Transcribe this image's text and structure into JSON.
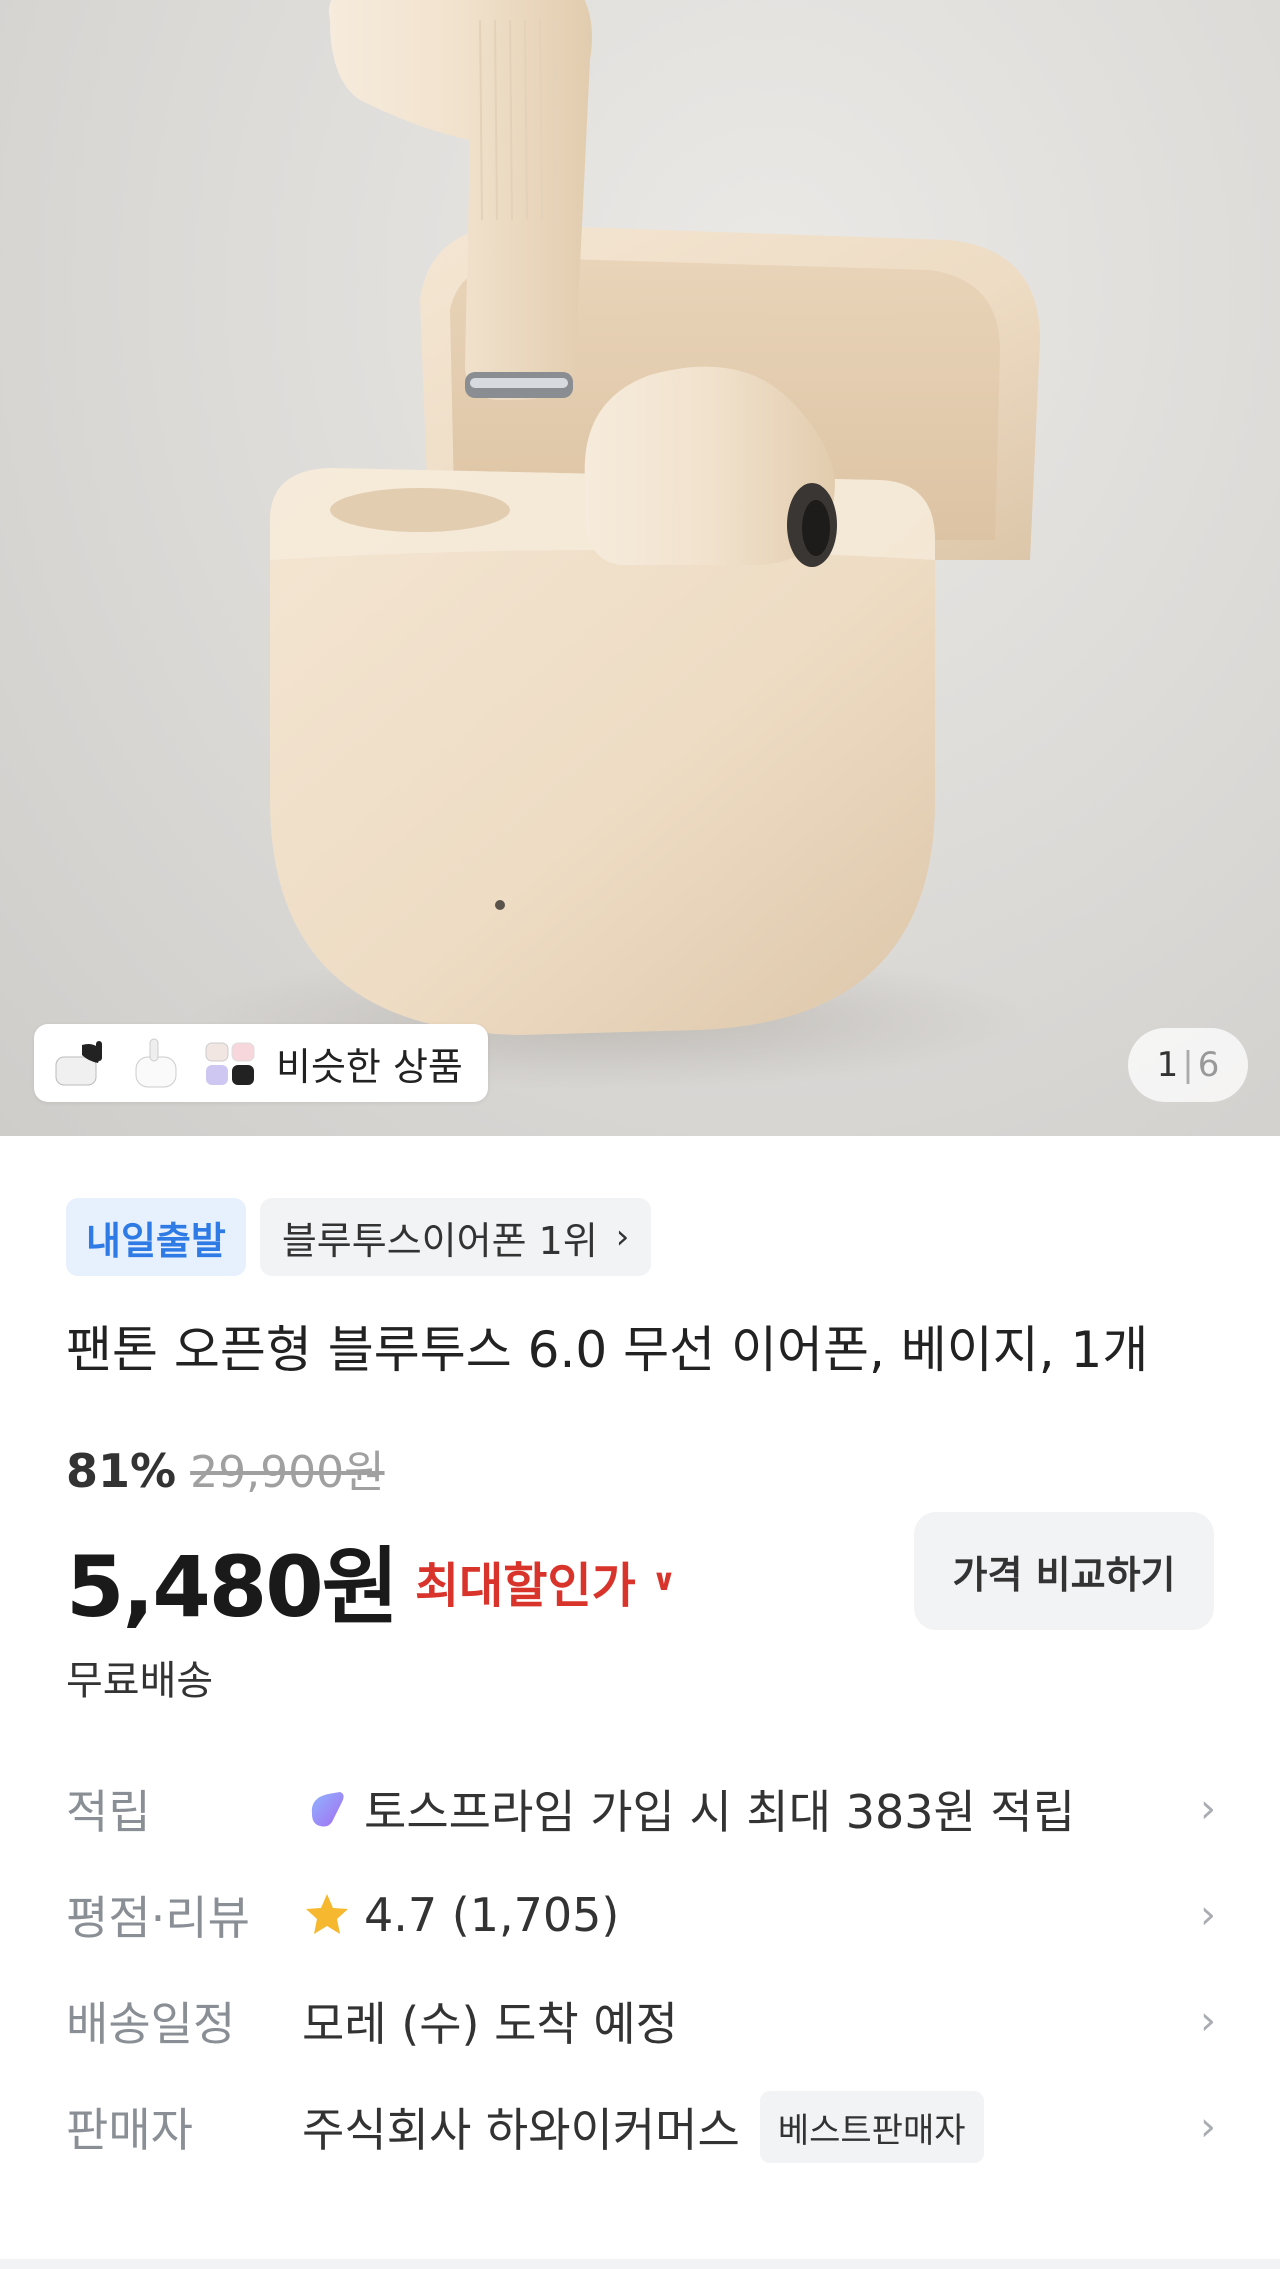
{
  "gallery": {
    "similar_label": "비슷한 상품",
    "page_current": "1",
    "page_sep": "|",
    "page_total": "6"
  },
  "badges": {
    "delivery": "내일출발",
    "rank": "블루투스이어폰 1위"
  },
  "product": {
    "title": "팬톤 오픈형 블루투스 6.0 무선 이어폰, 베이지, 1개",
    "discount_rate": "81%",
    "original_price": "29,900원",
    "price": "5,480원",
    "max_discount_label": "최대할인가",
    "compare_button": "가격 비교하기",
    "shipping": "무료배송"
  },
  "info_rows": [
    {
      "label": "적립",
      "value": "토스프라임 가입 시 최대 383원 적립",
      "icon": "toss-prime-icon"
    },
    {
      "label": "평점·리뷰",
      "value": "4.7 (1,705)",
      "icon": "star-icon"
    },
    {
      "label": "배송일정",
      "value": "모레 (수) 도착 예정"
    },
    {
      "label": "판매자",
      "value": "주식회사 하와이커머스",
      "badge": "베스트판매자"
    }
  ],
  "colors": {
    "accent_blue": "#2f7be5",
    "discount_red": "#d9342b",
    "star": "#f5b82e"
  }
}
